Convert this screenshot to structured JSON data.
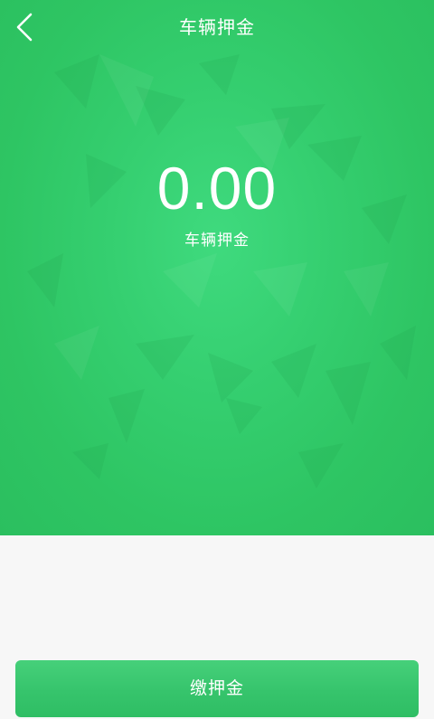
{
  "header": {
    "title": "车辆押金",
    "back_icon": "chevron-left-icon"
  },
  "deposit": {
    "amount": "0.00",
    "label": "车辆押金"
  },
  "actions": {
    "pay_label": "缴押金"
  },
  "colors": {
    "hero_green": "#35cf70",
    "button_green": "#36c46c",
    "page_background": "#f7f7f7",
    "text_white": "#ffffff"
  }
}
